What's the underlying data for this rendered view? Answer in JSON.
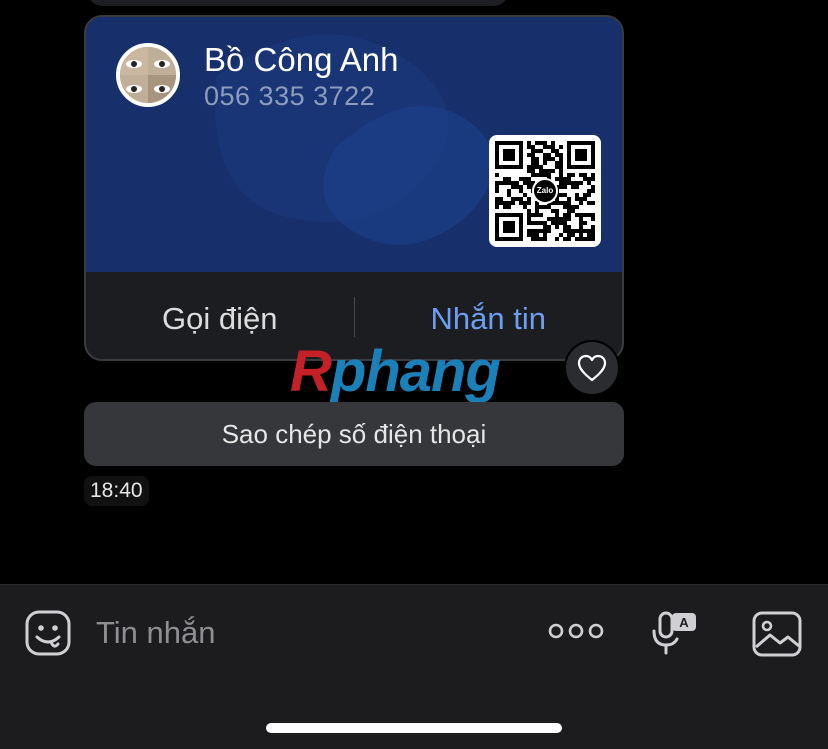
{
  "contact_card": {
    "name": "Bồ Công Anh",
    "phone": "056 335 3722",
    "qr_logo": "Zalo",
    "call_label": "Gọi điện",
    "message_label": "Nhắn tin",
    "card_color": "#17306b",
    "message_color": "#6d9ef2"
  },
  "watermark": {
    "first": "R",
    "rest": "phang"
  },
  "copy_phone_label": "Sao chép số điện thoại",
  "message_time": "18:40",
  "composer": {
    "placeholder": "Tin nhắn",
    "icons": [
      "sticker-icon",
      "more-icon",
      "voice-to-text-icon",
      "image-icon"
    ]
  }
}
